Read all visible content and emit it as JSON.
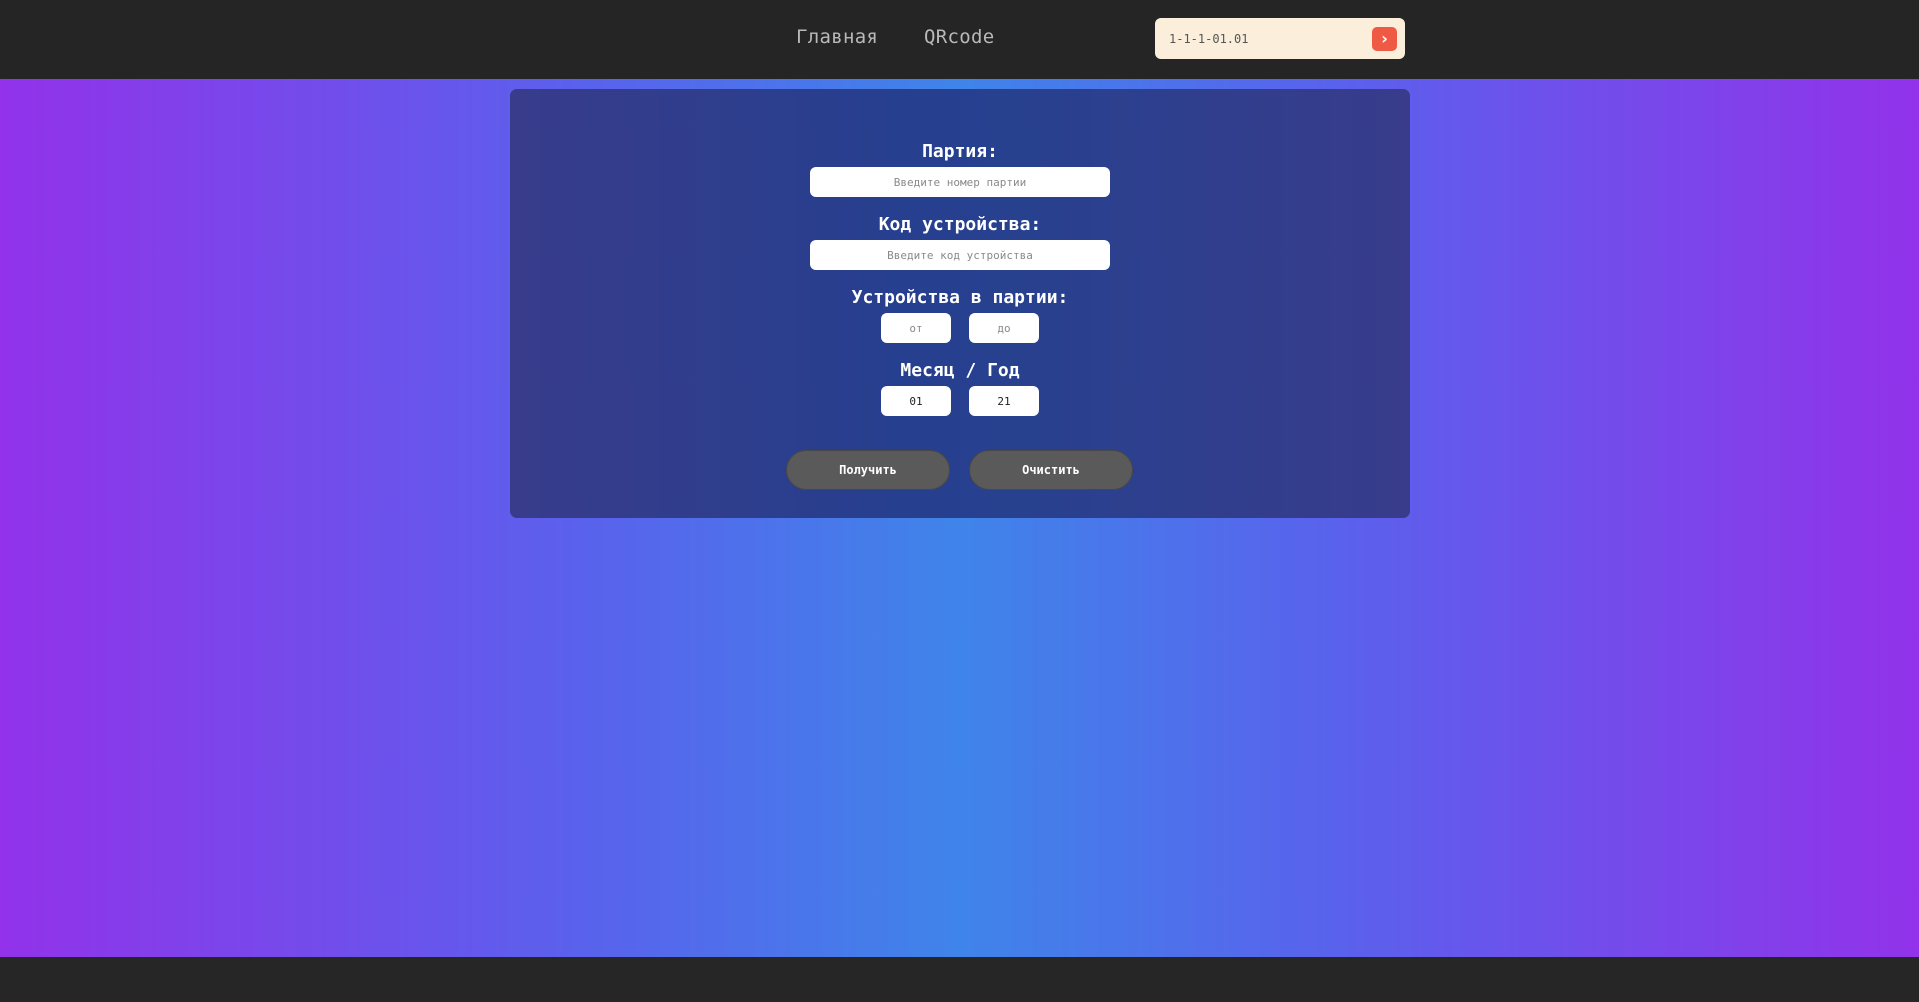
{
  "nav": {
    "home": "Главная",
    "qrcode": "QRcode"
  },
  "search": {
    "value": "1-1-1-01.01",
    "button_glyph": "›"
  },
  "form": {
    "party_label": "Партия:",
    "party_placeholder": "Введите номер партии",
    "device_code_label": "Код устройства:",
    "device_code_placeholder": "Введите код устройства",
    "devices_in_party_label": "Устройства в партии:",
    "from_placeholder": "от",
    "to_placeholder": "до",
    "month_year_label": "Месяц / Год",
    "month_value": "01",
    "year_value": "21",
    "get_button": "Получить",
    "clear_button": "Очистить"
  },
  "colors": {
    "header_bg": "#252525",
    "search_bg": "#fbefdc",
    "search_button": "#ef5a44",
    "gradient_edge": "#9232ea",
    "gradient_center": "#3f84ea",
    "panel_bg": "#263f8f",
    "button_bg": "#5a5a5a"
  }
}
